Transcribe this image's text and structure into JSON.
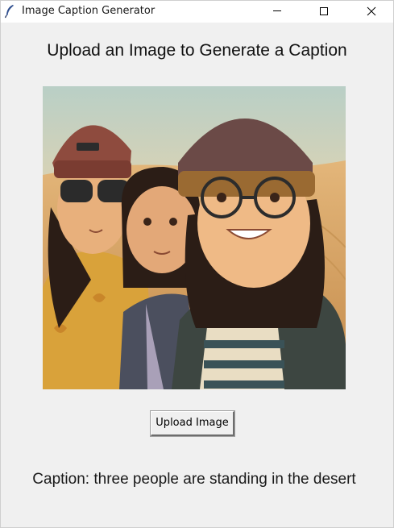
{
  "window": {
    "title": "Image Caption Generator"
  },
  "main": {
    "heading": "Upload an Image to Generate a Caption",
    "image_alt": "three friends selfie in desert (illustration)",
    "upload_button_label": "Upload Image",
    "caption_text": "Caption: three people are standing in the desert"
  },
  "icons": {
    "app": "feather-icon",
    "minimize": "minimize-icon",
    "maximize": "maximize-icon",
    "close": "close-icon"
  }
}
